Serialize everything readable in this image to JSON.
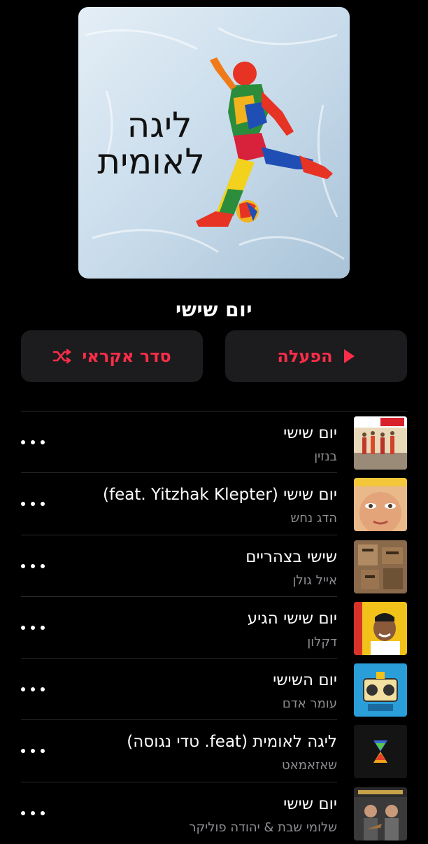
{
  "cover": {
    "line1": "ליגה",
    "line2": "לאומית"
  },
  "playlist": {
    "title": "יום שישי"
  },
  "actions": {
    "play_label": "הפעלה",
    "shuffle_label": "סדר אקראי"
  },
  "icons": {
    "play": "play-icon",
    "shuffle": "shuffle-icon",
    "more": "more-icon"
  },
  "colors": {
    "accent": "#fa2d48",
    "background": "#000000",
    "button_bg": "#1c1c1e",
    "secondary_text": "#8e8e93"
  },
  "tracks": [
    {
      "title": "יום שישי",
      "artist": "בנזין"
    },
    {
      "title": "יום שישי (feat. Yitzhak Klepter)",
      "artist": "הדג נחש"
    },
    {
      "title": "שישי בצהריים",
      "artist": "אייל גולן"
    },
    {
      "title": "יום שישי הגיע",
      "artist": "דקלון"
    },
    {
      "title": "יום השישי",
      "artist": "עומר אדם"
    },
    {
      "title": "ליגה לאומית (feat. טדי נגוסה)",
      "artist": "שאזאמאט"
    },
    {
      "title": "יום שישי",
      "artist": "שלומי שבת & יהודה פוליקר"
    }
  ]
}
